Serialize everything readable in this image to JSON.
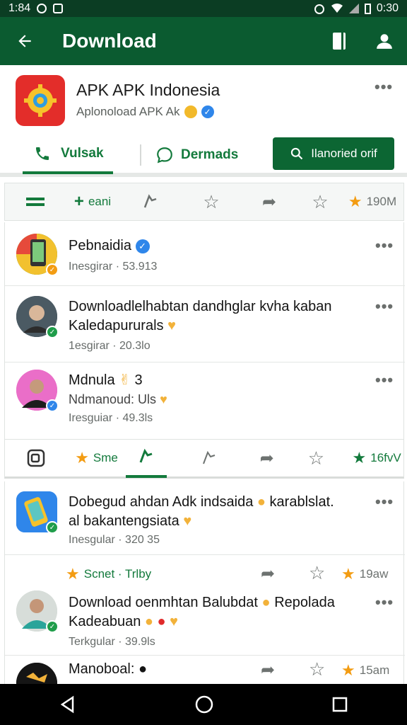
{
  "status": {
    "time": "1:84",
    "clock": "0:30"
  },
  "appbar": {
    "title": "Download"
  },
  "app": {
    "name": "APK APK Indonesia",
    "subtitle": "Aplonoload APK Ak",
    "tab_call": "Vulsak",
    "tab_chat": "Dermads",
    "button_label": "Ilanoried orif"
  },
  "actionbar1": {
    "item2": "eani",
    "rating": "190M"
  },
  "posts": [
    {
      "title": "Pebnaidia",
      "meta": "Inesgirar · 53.913"
    },
    {
      "line1": "Downloadlelhabtan dandhglar kvha kaban",
      "line2": "Kaledapururals",
      "meta": "1esgirar · 20.3lo"
    },
    {
      "line1": "Mdnula",
      "count": "3",
      "line2": "Ndmanoud: Uls",
      "meta": "Iresguiar · 49.3ls"
    },
    {
      "line1": "Dobegud ahdan Adk indsaida",
      "line1b": "karablslat.",
      "line2": "al bakantengsiata",
      "meta": "Inesgular · 320 35"
    },
    {
      "line1": "Download oenmhtan Balubdat",
      "line1b": "Repolada",
      "line2": "Kadeabuan",
      "meta": "Terkgular · 39.9ls"
    },
    {
      "line1": "Manoboal:"
    }
  ],
  "actionbar2": {
    "item1": "Sme",
    "rating": "16fvV"
  },
  "actionbar3": {
    "item1": "Scnet · Trlby",
    "rating": "19aw"
  },
  "actionbar4": {
    "rating": "15am"
  },
  "colors": {
    "primary": "#0b5b30",
    "accent": "#137a3c",
    "star": "#f39c12",
    "verified": "#2f86ea"
  }
}
